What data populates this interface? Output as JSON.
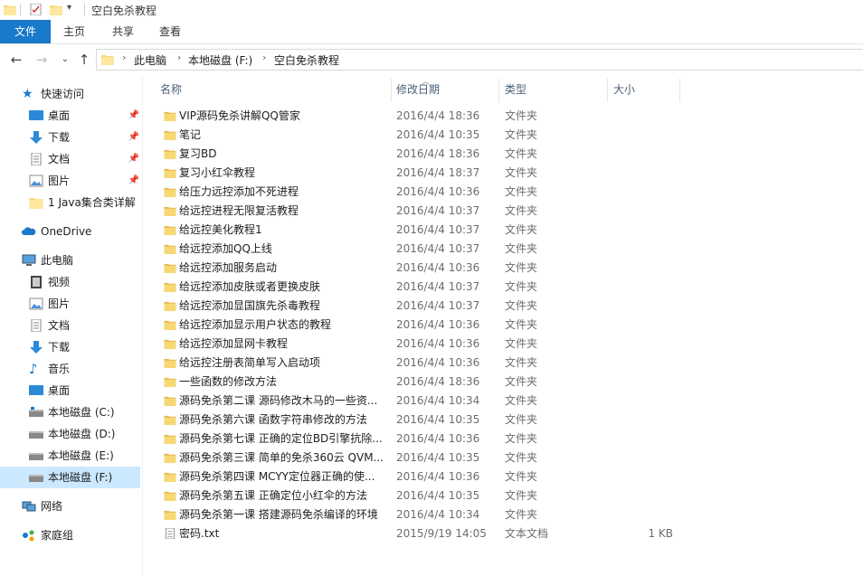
{
  "window": {
    "title": "空白免杀教程"
  },
  "ribbon": {
    "tabs": [
      "文件",
      "主页",
      "共享",
      "查看"
    ]
  },
  "address": {
    "crumbs": [
      "此电脑",
      "本地磁盘 (F:)",
      "空白免杀教程"
    ]
  },
  "nav": {
    "quick_access": "快速访问",
    "quick_items": [
      "桌面",
      "下载",
      "文档",
      "图片",
      "1 Java集合类详解"
    ],
    "onedrive": "OneDrive",
    "this_pc": "此电脑",
    "pc_items": [
      "视频",
      "图片",
      "文档",
      "下载",
      "音乐",
      "桌面",
      "本地磁盘 (C:)",
      "本地磁盘 (D:)",
      "本地磁盘 (E:)",
      "本地磁盘 (F:)"
    ],
    "network": "网络",
    "homegroup": "家庭组"
  },
  "columns": {
    "name": "名称",
    "date": "修改日期",
    "type": "类型",
    "size": "大小"
  },
  "files": [
    {
      "name": "VIP源码免杀讲解QQ管家",
      "date": "2016/4/4 18:36",
      "type": "文件夹",
      "size": ""
    },
    {
      "name": "笔记",
      "date": "2016/4/4 10:35",
      "type": "文件夹",
      "size": ""
    },
    {
      "name": "复习BD",
      "date": "2016/4/4 18:36",
      "type": "文件夹",
      "size": ""
    },
    {
      "name": "复习小红伞教程",
      "date": "2016/4/4 18:37",
      "type": "文件夹",
      "size": ""
    },
    {
      "name": "给压力远控添加不死进程",
      "date": "2016/4/4 10:36",
      "type": "文件夹",
      "size": ""
    },
    {
      "name": "给远控进程无限复活教程",
      "date": "2016/4/4 10:37",
      "type": "文件夹",
      "size": ""
    },
    {
      "name": "给远控美化教程1",
      "date": "2016/4/4 10:37",
      "type": "文件夹",
      "size": ""
    },
    {
      "name": "给远控添加QQ上线",
      "date": "2016/4/4 10:37",
      "type": "文件夹",
      "size": ""
    },
    {
      "name": "给远控添加服务启动",
      "date": "2016/4/4 10:36",
      "type": "文件夹",
      "size": ""
    },
    {
      "name": "给远控添加皮肤或者更换皮肤",
      "date": "2016/4/4 10:37",
      "type": "文件夹",
      "size": ""
    },
    {
      "name": "给远控添加显国旗先杀毒教程",
      "date": "2016/4/4 10:37",
      "type": "文件夹",
      "size": ""
    },
    {
      "name": "给远控添加显示用户状态的教程",
      "date": "2016/4/4 10:36",
      "type": "文件夹",
      "size": ""
    },
    {
      "name": "给远控添加显网卡教程",
      "date": "2016/4/4 10:36",
      "type": "文件夹",
      "size": ""
    },
    {
      "name": "给远控注册表简单写入启动项",
      "date": "2016/4/4 10:36",
      "type": "文件夹",
      "size": ""
    },
    {
      "name": "一些函数的修改方法",
      "date": "2016/4/4 18:36",
      "type": "文件夹",
      "size": ""
    },
    {
      "name": "源码免杀第二课 源码修改木马的一些资...",
      "date": "2016/4/4 10:34",
      "type": "文件夹",
      "size": ""
    },
    {
      "name": "源码免杀第六课 函数字符串修改的方法",
      "date": "2016/4/4 10:35",
      "type": "文件夹",
      "size": ""
    },
    {
      "name": "源码免杀第七课 正确的定位BD引擎抗除...",
      "date": "2016/4/4 10:36",
      "type": "文件夹",
      "size": ""
    },
    {
      "name": "源码免杀第三课 简单的免杀360云 QVM...",
      "date": "2016/4/4 10:35",
      "type": "文件夹",
      "size": ""
    },
    {
      "name": "源码免杀第四课 MCYY定位器正确的使...",
      "date": "2016/4/4 10:36",
      "type": "文件夹",
      "size": ""
    },
    {
      "name": "源码免杀第五课 正确定位小红伞的方法",
      "date": "2016/4/4 10:35",
      "type": "文件夹",
      "size": ""
    },
    {
      "name": "源码免杀第一课 搭建源码免杀编译的环境",
      "date": "2016/4/4 10:34",
      "type": "文件夹",
      "size": ""
    },
    {
      "name": "密码.txt",
      "date": "2015/9/19 14:05",
      "type": "文本文档",
      "size": "1 KB"
    }
  ],
  "colors": {
    "accent": "#1979ca",
    "folder": "#f8d775",
    "selected": "#cce8ff"
  }
}
